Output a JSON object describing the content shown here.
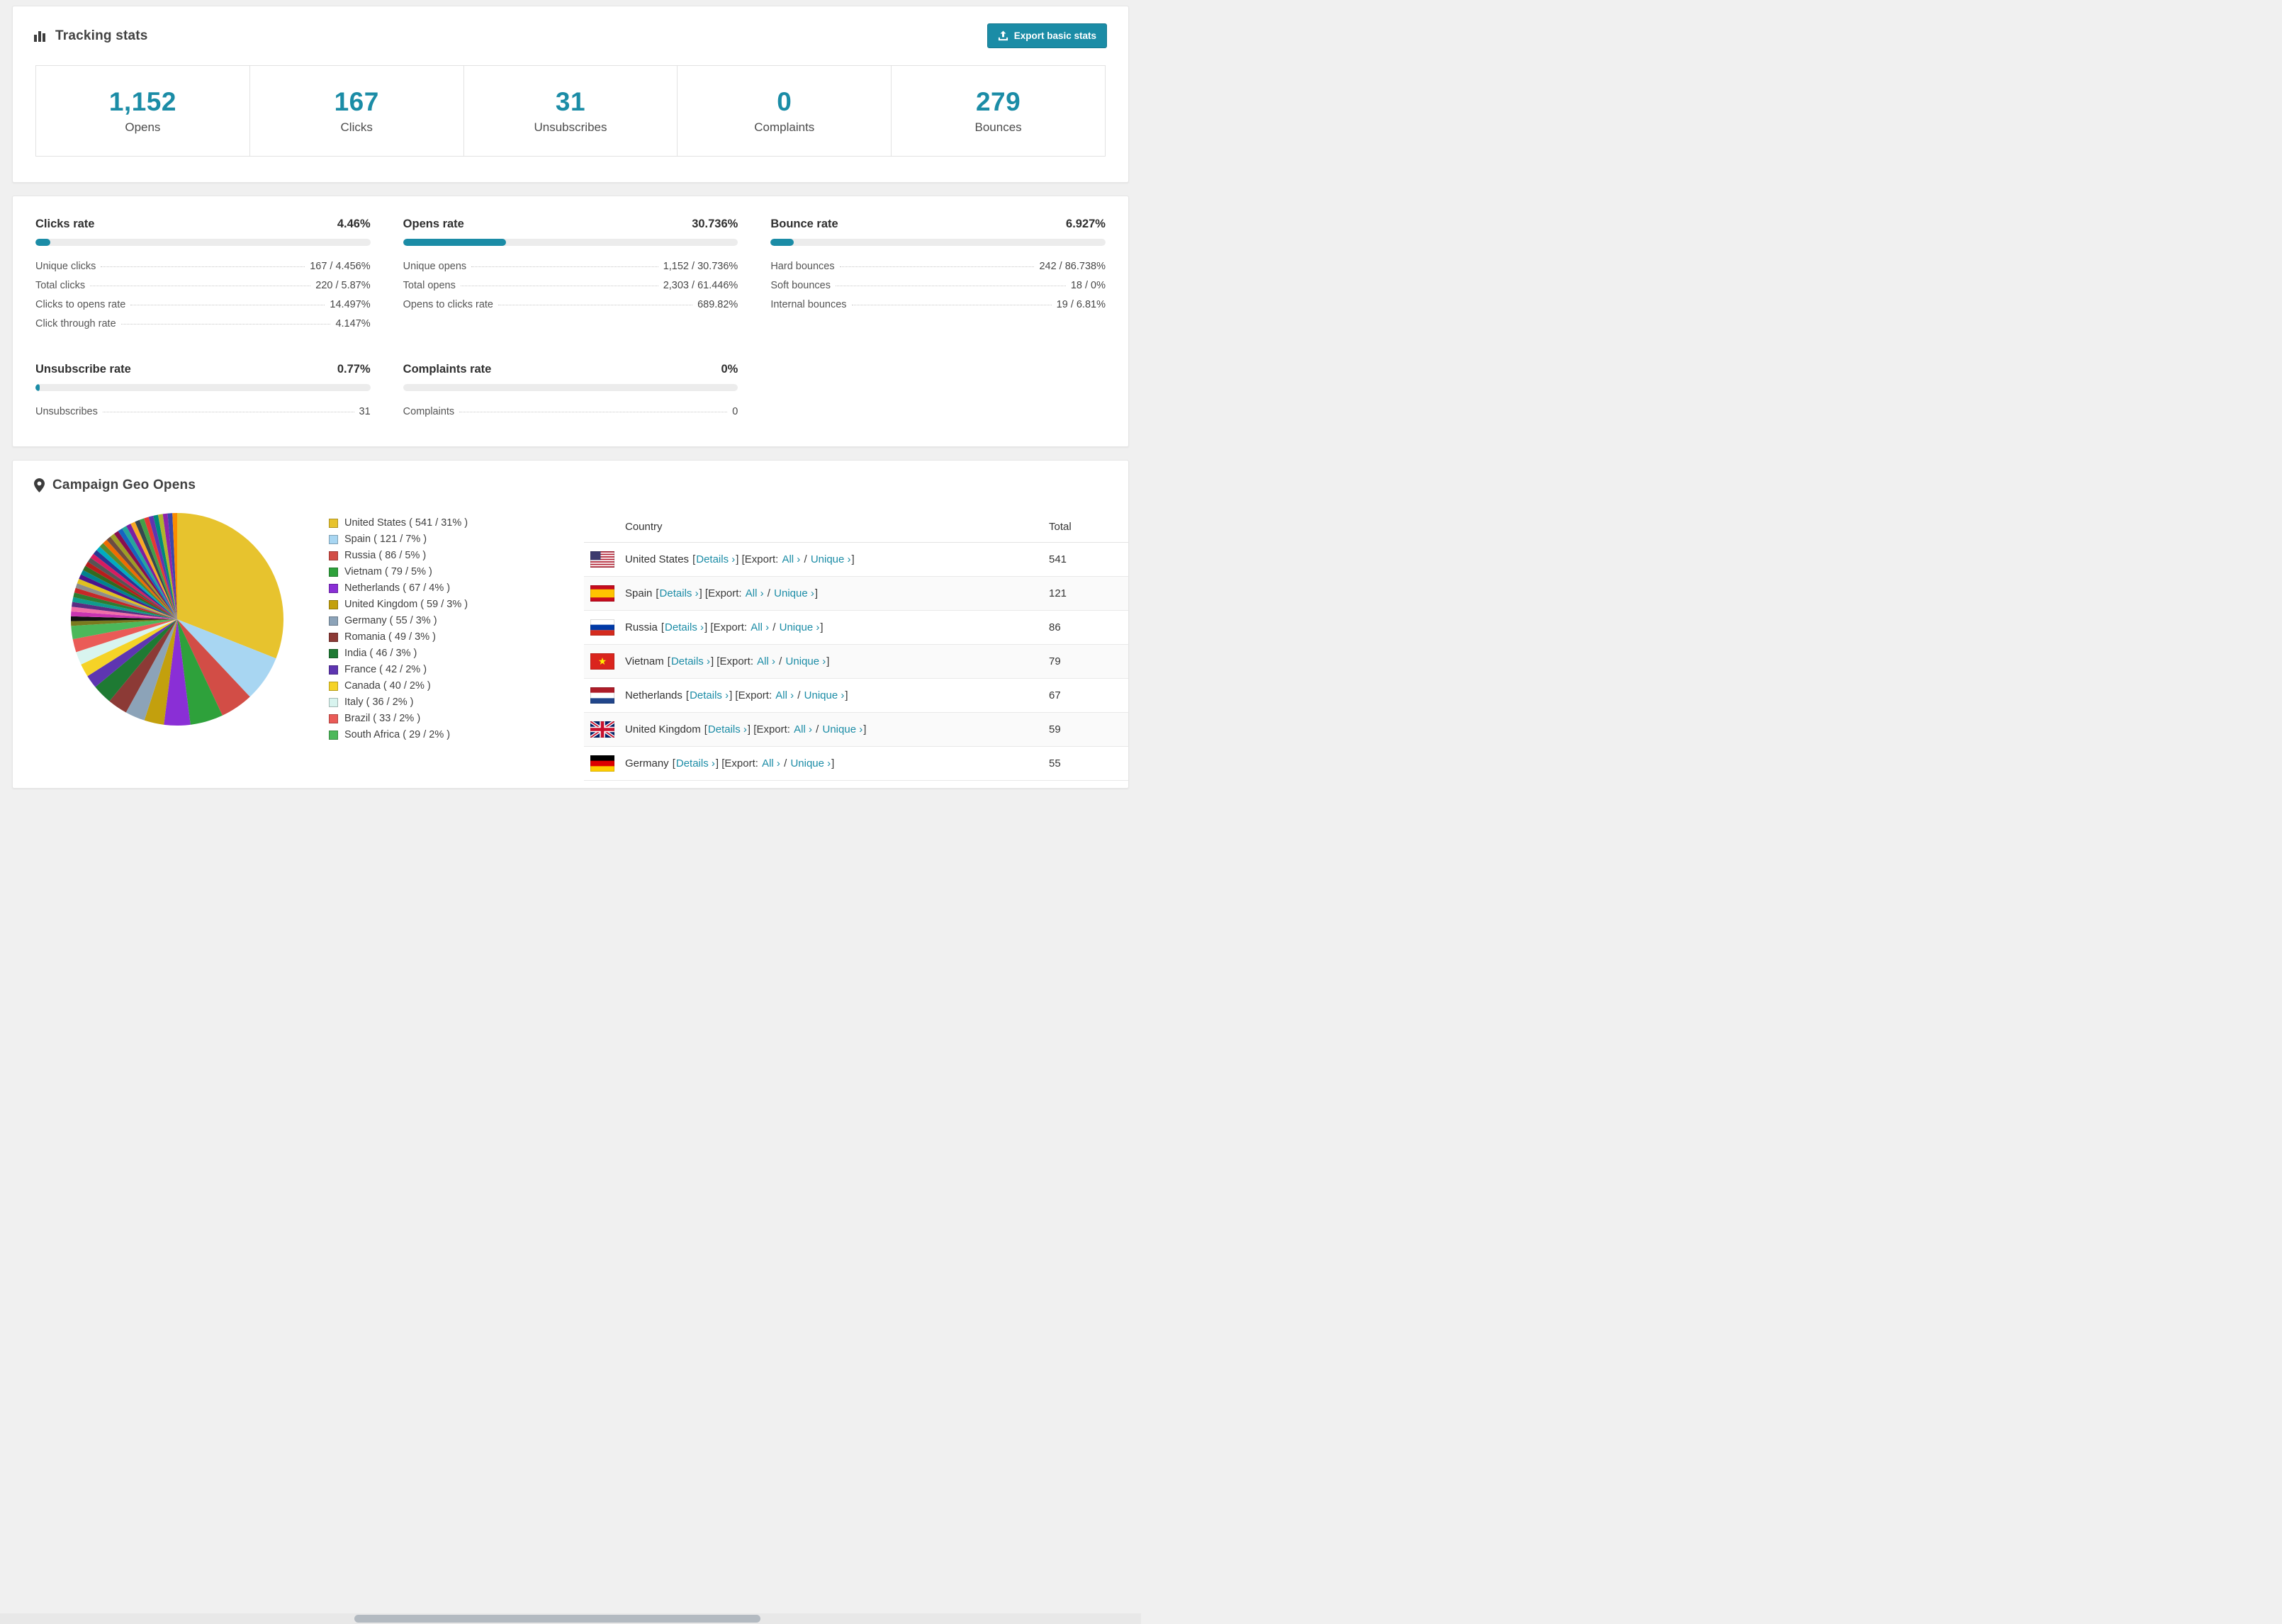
{
  "accent_color": "#1b8ca6",
  "tracking": {
    "title": "Tracking stats",
    "export_label": "Export basic stats",
    "stats": [
      {
        "value": "1,152",
        "label": "Opens"
      },
      {
        "value": "167",
        "label": "Clicks"
      },
      {
        "value": "31",
        "label": "Unsubscribes"
      },
      {
        "value": "0",
        "label": "Complaints"
      },
      {
        "value": "279",
        "label": "Bounces"
      }
    ]
  },
  "rates": [
    {
      "title": "Clicks rate",
      "value": "4.46%",
      "percent": 4.46,
      "rows": [
        {
          "label": "Unique clicks",
          "value": "167 / 4.456%"
        },
        {
          "label": "Total clicks",
          "value": "220 / 5.87%"
        },
        {
          "label": "Clicks to opens rate",
          "value": "14.497%"
        },
        {
          "label": "Click through rate",
          "value": "4.147%"
        }
      ]
    },
    {
      "title": "Opens rate",
      "value": "30.736%",
      "percent": 30.736,
      "rows": [
        {
          "label": "Unique opens",
          "value": "1,152 / 30.736%"
        },
        {
          "label": "Total opens",
          "value": "2,303 / 61.446%"
        },
        {
          "label": "Opens to clicks rate",
          "value": "689.82%"
        }
      ]
    },
    {
      "title": "Bounce rate",
      "value": "6.927%",
      "percent": 6.927,
      "rows": [
        {
          "label": "Hard bounces",
          "value": "242 / 86.738%"
        },
        {
          "label": "Soft bounces",
          "value": "18 / 0%"
        },
        {
          "label": "Internal bounces",
          "value": "19 / 6.81%"
        }
      ]
    },
    {
      "title": "Unsubscribe rate",
      "value": "0.77%",
      "percent": 0.77,
      "rows": [
        {
          "label": "Unsubscribes",
          "value": "31"
        }
      ]
    },
    {
      "title": "Complaints rate",
      "value": "0%",
      "percent": 0,
      "rows": [
        {
          "label": "Complaints",
          "value": "0"
        }
      ]
    }
  ],
  "geo": {
    "title": "Campaign Geo Opens",
    "chart_data": {
      "type": "pie",
      "title": "Campaign Geo Opens",
      "labels": [
        "United States",
        "Spain",
        "Russia",
        "Vietnam",
        "Netherlands",
        "United Kingdom",
        "Germany",
        "Romania",
        "India",
        "France",
        "Canada",
        "Italy",
        "Brazil",
        "South Africa"
      ],
      "values": [
        541,
        121,
        86,
        79,
        67,
        59,
        55,
        49,
        46,
        42,
        40,
        36,
        33,
        29
      ],
      "percents": [
        31,
        7,
        5,
        5,
        4,
        3,
        3,
        3,
        3,
        2,
        2,
        2,
        2,
        2
      ],
      "colors": [
        "#e7c32e",
        "#a8d6f2",
        "#d24d46",
        "#2ea13b",
        "#8a2fd6",
        "#c3a00d",
        "#8ca3b8",
        "#8c3a36",
        "#1e7a33",
        "#5e35b1",
        "#f5d327",
        "#d8f4ef",
        "#ea5b57",
        "#4cb85a"
      ],
      "other_total_percent": 26,
      "other_colors": [
        "#7a7a1e",
        "#111111",
        "#c934b0",
        "#f06fa8",
        "#5a2d82",
        "#0f9b8e",
        "#2e7d32",
        "#c62828",
        "#8d8d8d",
        "#e0c020",
        "#4a148c",
        "#00838f",
        "#33691e",
        "#b71c1c",
        "#555555",
        "#d81b60",
        "#283593",
        "#00acc1",
        "#558b2f",
        "#ef6c00",
        "#6d4c41",
        "#9e9d24",
        "#880e4f",
        "#1565c0",
        "#26a69a",
        "#7b1fa2",
        "#f9a825",
        "#37474f",
        "#43a047",
        "#e53935",
        "#5e35b1",
        "#00897b",
        "#afb42b",
        "#8e24aa",
        "#3949ab",
        "#fb8c00"
      ],
      "legend_position": "right"
    },
    "table": {
      "headers": {
        "country": "Country",
        "total": "Total"
      },
      "links": {
        "details": "Details ›",
        "export_prefix": "Export:",
        "all": "All ›",
        "unique": "Unique ›"
      },
      "rows": [
        {
          "country": "United States",
          "total": "541",
          "flag": "us"
        },
        {
          "country": "Spain",
          "total": "121",
          "flag": "es"
        },
        {
          "country": "Russia",
          "total": "86",
          "flag": "ru"
        },
        {
          "country": "Vietnam",
          "total": "79",
          "flag": "vn"
        },
        {
          "country": "Netherlands",
          "total": "67",
          "flag": "nl"
        },
        {
          "country": "United Kingdom",
          "total": "59",
          "flag": "gb"
        },
        {
          "country": "Germany",
          "total": "55",
          "flag": "de"
        }
      ]
    }
  }
}
